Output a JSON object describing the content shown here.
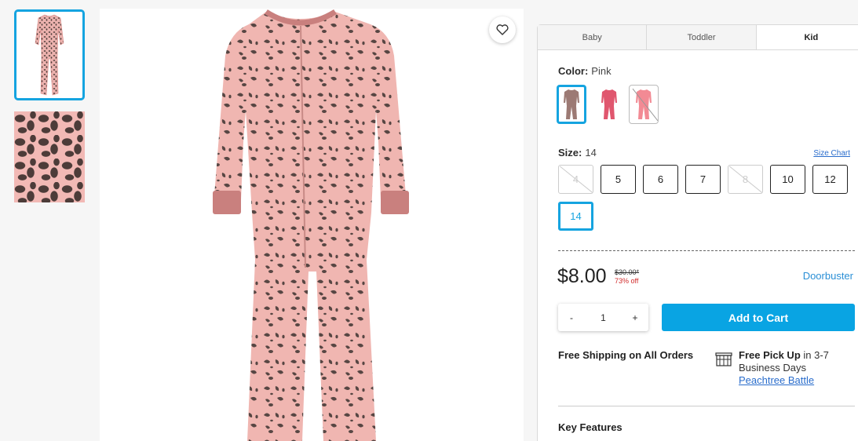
{
  "thumbnails": [
    {
      "icon": "pajama-full-thumbnail"
    },
    {
      "icon": "leopard-pattern-closeup-thumbnail"
    }
  ],
  "main_image": {
    "icon": "pink-leopard-pajama-image",
    "favorite_icon": "heart-icon"
  },
  "tabs": [
    {
      "label": "Baby"
    },
    {
      "label": "Toddler"
    },
    {
      "label": "Kid",
      "active": true
    }
  ],
  "color": {
    "label": "Color:",
    "value": "Pink",
    "swatches": [
      {
        "name": "leopard",
        "state": "selected"
      },
      {
        "name": "pink-print",
        "state": "available"
      },
      {
        "name": "light-pink",
        "state": "unavailable"
      }
    ]
  },
  "size": {
    "label": "Size:",
    "value": "14",
    "chart_link": "Size Chart",
    "options": [
      {
        "label": "4",
        "state": "unavailable"
      },
      {
        "label": "5",
        "state": "available"
      },
      {
        "label": "6",
        "state": "available"
      },
      {
        "label": "7",
        "state": "available"
      },
      {
        "label": "8",
        "state": "unavailable"
      },
      {
        "label": "10",
        "state": "available"
      },
      {
        "label": "12",
        "state": "available"
      },
      {
        "label": "14",
        "state": "selected"
      }
    ]
  },
  "pricing": {
    "price": "$8.00",
    "original": "$30.00*",
    "discount": "73% off",
    "tag": "Doorbuster"
  },
  "quantity": {
    "minus": "-",
    "value": "1",
    "plus": "+"
  },
  "add_to_cart": "Add to Cart",
  "shipping": {
    "free_shipping": "Free Shipping on All Orders",
    "pickup_title": "Free Pick Up",
    "pickup_text": " in 3-7 Business Days",
    "store_link": "Peachtree Battle",
    "store_icon": "store-icon"
  },
  "key_features": "Key Features",
  "colors": {
    "accent": "#15a4e0",
    "button": "#09a4e3",
    "sale": "#d12a2a",
    "link": "#2a6dcc"
  }
}
